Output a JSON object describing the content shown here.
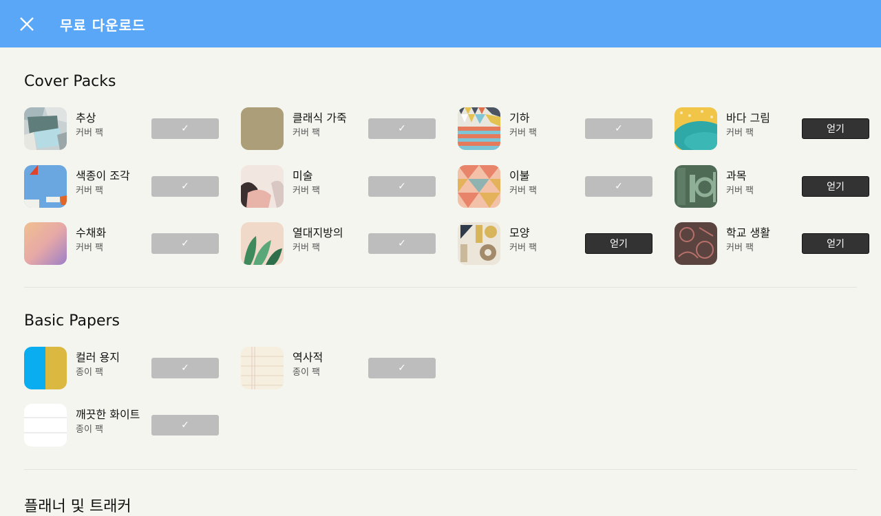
{
  "header": {
    "title": "무료 다운로드",
    "close_icon": "close-icon"
  },
  "sections": [
    {
      "title": "Cover Packs",
      "items": [
        {
          "name": "추상",
          "sub": "커버 팩",
          "button": "✓",
          "state": "downloaded"
        },
        {
          "name": "클래식 가죽",
          "sub": "커버 팩",
          "button": "✓",
          "state": "downloaded"
        },
        {
          "name": "기하",
          "sub": "커버 팩",
          "button": "✓",
          "state": "downloaded"
        },
        {
          "name": "바다 그림",
          "sub": "커버 팩",
          "button": "얻기",
          "state": "get"
        },
        {
          "name": "색종이 조각",
          "sub": "커버 팩",
          "button": "✓",
          "state": "downloaded"
        },
        {
          "name": "미술",
          "sub": "커버 팩",
          "button": "✓",
          "state": "downloaded"
        },
        {
          "name": "이불",
          "sub": "커버 팩",
          "button": "✓",
          "state": "downloaded"
        },
        {
          "name": "과목",
          "sub": "커버 팩",
          "button": "얻기",
          "state": "get"
        },
        {
          "name": "수채화",
          "sub": "커버 팩",
          "button": "✓",
          "state": "downloaded"
        },
        {
          "name": "열대지방의",
          "sub": "커버 팩",
          "button": "✓",
          "state": "downloaded"
        },
        {
          "name": "모양",
          "sub": "커버 팩",
          "button": "얻기",
          "state": "get"
        },
        {
          "name": "학교 생활",
          "sub": "커버 팩",
          "button": "얻기",
          "state": "get"
        }
      ]
    },
    {
      "title": "Basic Papers",
      "items": [
        {
          "name": "컬러 용지",
          "sub": "종이 팩",
          "button": "✓",
          "state": "downloaded"
        },
        {
          "name": "역사적",
          "sub": "종이 팩",
          "button": "✓",
          "state": "downloaded"
        },
        {
          "name": "깨끗한 화이트",
          "sub": "종이 팩",
          "button": "✓",
          "state": "downloaded"
        }
      ]
    },
    {
      "title": "플래너 및 트래커"
    }
  ],
  "colors": {
    "header_bg": "#5aa6f7",
    "page_bg": "#f5f5f0",
    "downloaded_button": "#bdbdbd",
    "get_button": "#333333"
  }
}
